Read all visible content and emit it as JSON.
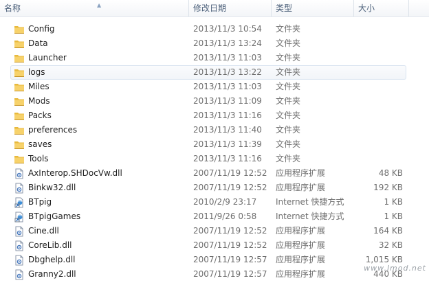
{
  "columns": {
    "name": "名称",
    "date": "修改日期",
    "type": "类型",
    "size": "大小"
  },
  "files": [
    {
      "name": "Config",
      "date": "2013/11/3 10:54",
      "type": "文件夹",
      "size": "",
      "icon": "folder-icon"
    },
    {
      "name": "Data",
      "date": "2013/11/3 13:24",
      "type": "文件夹",
      "size": "",
      "icon": "folder-icon"
    },
    {
      "name": "Launcher",
      "date": "2013/11/3 11:03",
      "type": "文件夹",
      "size": "",
      "icon": "folder-icon"
    },
    {
      "name": "logs",
      "date": "2013/11/3 13:22",
      "type": "文件夹",
      "size": "",
      "icon": "folder-icon",
      "selected": true
    },
    {
      "name": "Miles",
      "date": "2013/11/3 11:03",
      "type": "文件夹",
      "size": "",
      "icon": "folder-icon"
    },
    {
      "name": "Mods",
      "date": "2013/11/3 11:09",
      "type": "文件夹",
      "size": "",
      "icon": "folder-icon"
    },
    {
      "name": "Packs",
      "date": "2013/11/3 11:16",
      "type": "文件夹",
      "size": "",
      "icon": "folder-icon"
    },
    {
      "name": "preferences",
      "date": "2013/11/3 11:40",
      "type": "文件夹",
      "size": "",
      "icon": "folder-icon"
    },
    {
      "name": "saves",
      "date": "2013/11/3 11:39",
      "type": "文件夹",
      "size": "",
      "icon": "folder-icon"
    },
    {
      "name": "Tools",
      "date": "2013/11/3 11:16",
      "type": "文件夹",
      "size": "",
      "icon": "folder-icon"
    },
    {
      "name": "AxInterop.SHDocVw.dll",
      "date": "2007/11/19 12:52",
      "type": "应用程序扩展",
      "size": "48 KB",
      "icon": "dll-file-icon"
    },
    {
      "name": "Binkw32.dll",
      "date": "2007/11/19 12:52",
      "type": "应用程序扩展",
      "size": "192 KB",
      "icon": "dll-file-icon"
    },
    {
      "name": "BTpig",
      "date": "2010/2/9 23:17",
      "type": "Internet 快捷方式",
      "size": "1 KB",
      "icon": "internet-shortcut-icon"
    },
    {
      "name": "BTpigGames",
      "date": "2011/9/26 0:58",
      "type": "Internet 快捷方式",
      "size": "1 KB",
      "icon": "internet-shortcut-icon"
    },
    {
      "name": "Cine.dll",
      "date": "2007/11/19 12:52",
      "type": "应用程序扩展",
      "size": "164 KB",
      "icon": "dll-file-icon"
    },
    {
      "name": "CoreLib.dll",
      "date": "2007/11/19 12:52",
      "type": "应用程序扩展",
      "size": "32 KB",
      "icon": "dll-file-icon"
    },
    {
      "name": "Dbghelp.dll",
      "date": "2007/11/19 12:57",
      "type": "应用程序扩展",
      "size": "1,015 KB",
      "icon": "dll-file-icon"
    },
    {
      "name": "Granny2.dll",
      "date": "2007/11/19 12:57",
      "type": "应用程序扩展",
      "size": "440 KB",
      "icon": "dll-file-icon"
    }
  ],
  "watermark": "www.lmod.net"
}
